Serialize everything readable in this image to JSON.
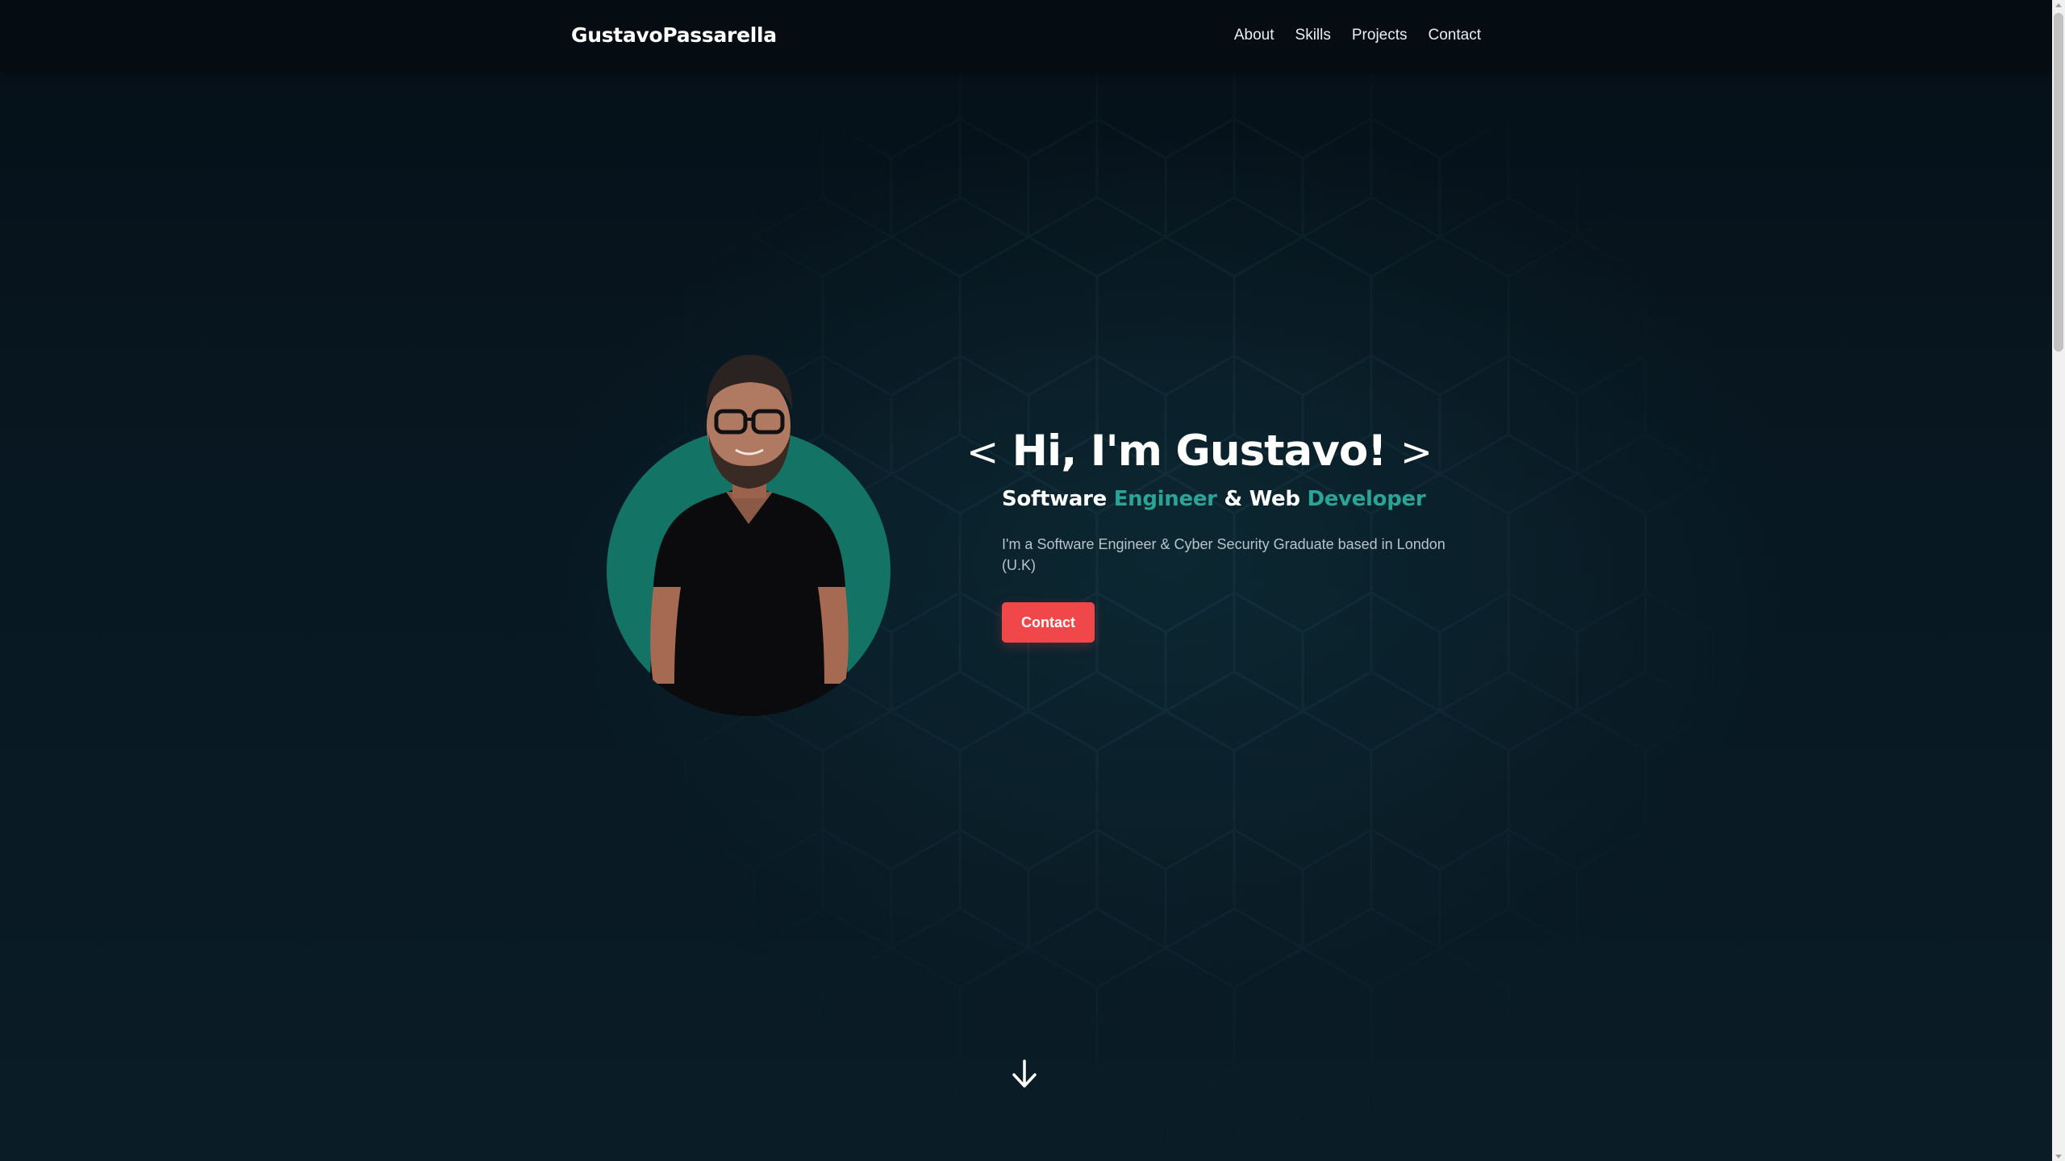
{
  "navbar": {
    "brand": "GustavoPassarella",
    "links": [
      "About",
      "Skills",
      "Projects",
      "Contact"
    ]
  },
  "hero": {
    "bracket_open": "<",
    "title": "Hi, I'm Gustavo!",
    "bracket_close": ">",
    "subtitle": {
      "part1": "Software ",
      "accent1": "Engineer",
      "part2": " & Web ",
      "accent2": "Developer"
    },
    "description": "I'm a Software Engineer & Cyber Security Graduate based in London (U.K)",
    "contact_button": "Contact"
  },
  "icons": {
    "scroll_down": "arrow-down-icon",
    "profile_photo": "profile-photo"
  },
  "colors": {
    "accent": "#2ba497",
    "button": "#f0474a",
    "background": "#07131b",
    "navbar": "#050d13",
    "photo_circle": "#137465"
  }
}
